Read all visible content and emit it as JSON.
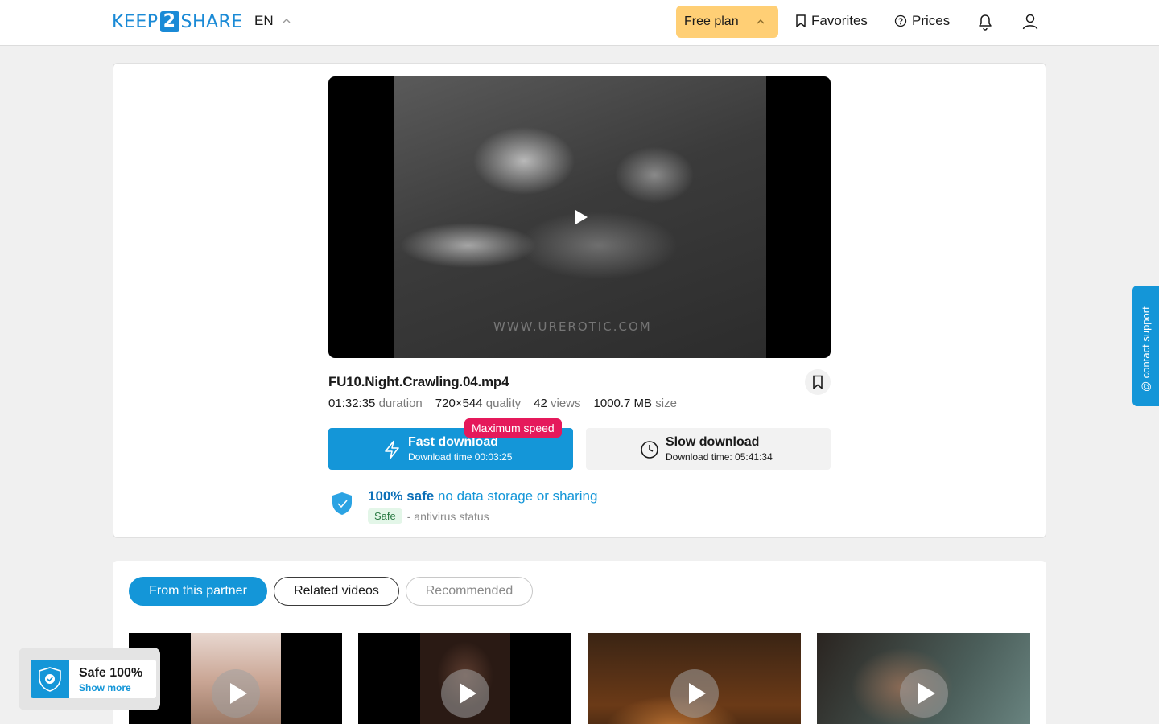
{
  "header": {
    "logo": {
      "left": "KEEP",
      "mid": "2",
      "right": "SHARE"
    },
    "language": "EN",
    "plan_label": "Free plan",
    "favorites_label": "Favorites",
    "prices_label": "Prices"
  },
  "video": {
    "watermark": "WWW.UREROTIC.COM"
  },
  "file": {
    "name": "FU10.Night.Crawling.04.mp4",
    "meta": [
      {
        "value": "01:32:35",
        "label": "duration"
      },
      {
        "value": "720×544",
        "label": "quality"
      },
      {
        "value": "42",
        "label": "views"
      },
      {
        "value": "1000.7 MB",
        "label": "size"
      }
    ]
  },
  "download": {
    "fast_title": "Fast download",
    "fast_time": "Download time 00:03:25",
    "badge": "Maximum speed",
    "slow_title": "Slow download",
    "slow_time": "Download time: 05:41:34"
  },
  "safety": {
    "strong": "100% safe",
    "light": "no data storage or sharing",
    "tag": "Safe",
    "status_text": "- antivirus status"
  },
  "tabs": [
    "From this partner",
    "Related videos",
    "Recommended"
  ],
  "contact_label": "@ contact support",
  "safe_widget": {
    "title": "Safe 100%",
    "link": "Show more"
  },
  "colors": {
    "brand": "#1496d8",
    "plan": "#ffcf75",
    "badge": "#e5195b"
  }
}
